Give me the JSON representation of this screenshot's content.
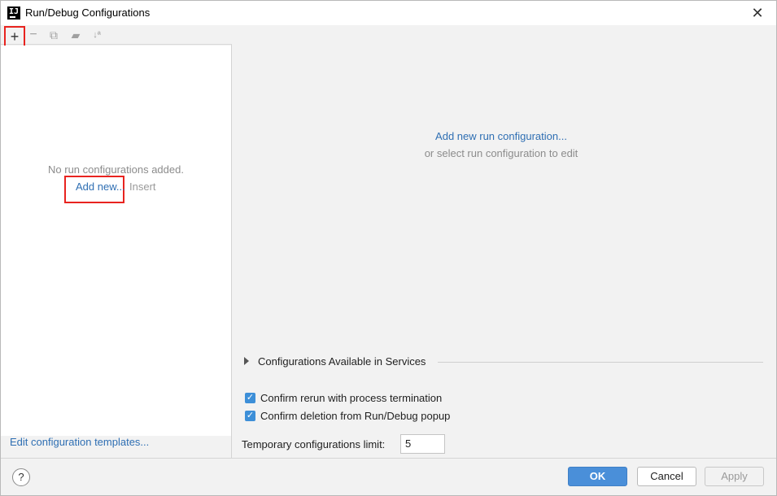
{
  "window": {
    "title": "Run/Debug Configurations",
    "close_label": "✕"
  },
  "toolbar": {
    "add_label": "+",
    "remove_label": "−",
    "copy_label": "⧉",
    "folder_label": "▰",
    "sort_label": "↓ª"
  },
  "left": {
    "empty_message": "No run configurations added.",
    "add_new_link": "Add new...",
    "insert_hint": "Insert",
    "templates_link": "Edit configuration templates..."
  },
  "right": {
    "add_run_link": "Add new run configuration...",
    "select_hint": "or select run configuration to edit",
    "services_label": "Configurations Available in Services",
    "confirm_rerun": "Confirm rerun with process termination",
    "confirm_deletion": "Confirm deletion from Run/Debug popup",
    "limit_label": "Temporary configurations limit:",
    "limit_value": "5",
    "confirm_rerun_checked": true,
    "confirm_deletion_checked": true
  },
  "buttons": {
    "help": "?",
    "ok": "OK",
    "cancel": "Cancel",
    "apply": "Apply"
  },
  "colors": {
    "link": "#2f6fb3",
    "highlight": "#e8231f",
    "primary_button": "#4a8fd9",
    "checkbox": "#3d8fd8"
  }
}
